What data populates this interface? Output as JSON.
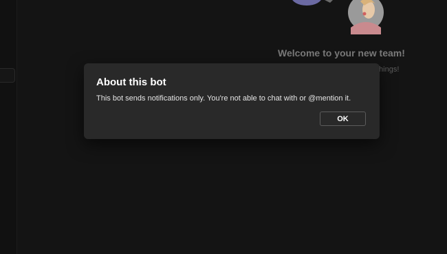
{
  "background": {
    "welcome_title": "Welcome to your new team!",
    "welcome_subtitle_fragment": "things!"
  },
  "dialog": {
    "title": "About this bot",
    "message": "This bot sends notifications only. You're not able to chat with or @mention it.",
    "ok_label": "OK"
  },
  "colors": {
    "page_background": "#141414",
    "dialog_background": "#292929",
    "dialog_text": "#ffffff",
    "button_border": "#5c5c5c"
  }
}
